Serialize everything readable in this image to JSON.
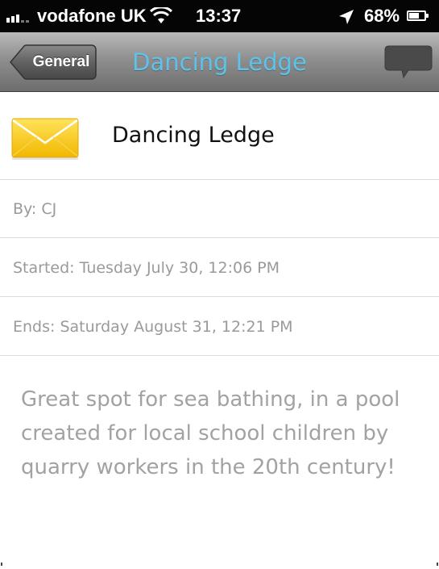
{
  "status_bar": {
    "carrier": "vodafone UK",
    "time": "13:37",
    "battery": "68%",
    "battery_level": 0.68,
    "signal_bars_filled": 3,
    "signal_bars_total": 5
  },
  "nav": {
    "back_label": "General",
    "title": "Dancing Ledge",
    "title_color": "#5dc3ea"
  },
  "post": {
    "icon": "envelope-icon",
    "title": "Dancing Ledge",
    "author": "By: CJ",
    "started": "Started: Tuesday July 30, 12:06 PM",
    "ends": "Ends: Saturday August 31, 12:21 PM",
    "description": "Great spot for sea bathing, in a pool created for local school children by quarry workers in the 20th century!"
  },
  "icons": [
    "signal-icon",
    "wifi-icon",
    "location-arrow-icon",
    "battery-icon",
    "back-chevron-icon",
    "chat-bubble-icon",
    "envelope-icon"
  ]
}
